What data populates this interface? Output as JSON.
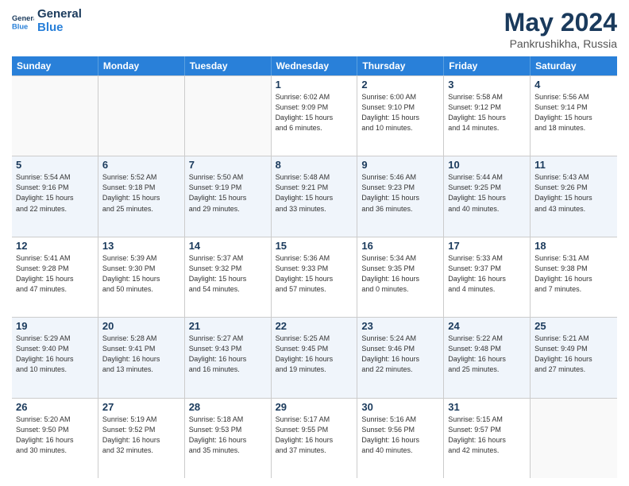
{
  "logo": {
    "line1": "General",
    "line2": "Blue"
  },
  "title": {
    "month_year": "May 2024",
    "location": "Pankrushikha, Russia"
  },
  "days_of_week": [
    "Sunday",
    "Monday",
    "Tuesday",
    "Wednesday",
    "Thursday",
    "Friday",
    "Saturday"
  ],
  "weeks": [
    [
      {
        "day": "",
        "info": ""
      },
      {
        "day": "",
        "info": ""
      },
      {
        "day": "",
        "info": ""
      },
      {
        "day": "1",
        "info": "Sunrise: 6:02 AM\nSunset: 9:09 PM\nDaylight: 15 hours\nand 6 minutes."
      },
      {
        "day": "2",
        "info": "Sunrise: 6:00 AM\nSunset: 9:10 PM\nDaylight: 15 hours\nand 10 minutes."
      },
      {
        "day": "3",
        "info": "Sunrise: 5:58 AM\nSunset: 9:12 PM\nDaylight: 15 hours\nand 14 minutes."
      },
      {
        "day": "4",
        "info": "Sunrise: 5:56 AM\nSunset: 9:14 PM\nDaylight: 15 hours\nand 18 minutes."
      }
    ],
    [
      {
        "day": "5",
        "info": "Sunrise: 5:54 AM\nSunset: 9:16 PM\nDaylight: 15 hours\nand 22 minutes."
      },
      {
        "day": "6",
        "info": "Sunrise: 5:52 AM\nSunset: 9:18 PM\nDaylight: 15 hours\nand 25 minutes."
      },
      {
        "day": "7",
        "info": "Sunrise: 5:50 AM\nSunset: 9:19 PM\nDaylight: 15 hours\nand 29 minutes."
      },
      {
        "day": "8",
        "info": "Sunrise: 5:48 AM\nSunset: 9:21 PM\nDaylight: 15 hours\nand 33 minutes."
      },
      {
        "day": "9",
        "info": "Sunrise: 5:46 AM\nSunset: 9:23 PM\nDaylight: 15 hours\nand 36 minutes."
      },
      {
        "day": "10",
        "info": "Sunrise: 5:44 AM\nSunset: 9:25 PM\nDaylight: 15 hours\nand 40 minutes."
      },
      {
        "day": "11",
        "info": "Sunrise: 5:43 AM\nSunset: 9:26 PM\nDaylight: 15 hours\nand 43 minutes."
      }
    ],
    [
      {
        "day": "12",
        "info": "Sunrise: 5:41 AM\nSunset: 9:28 PM\nDaylight: 15 hours\nand 47 minutes."
      },
      {
        "day": "13",
        "info": "Sunrise: 5:39 AM\nSunset: 9:30 PM\nDaylight: 15 hours\nand 50 minutes."
      },
      {
        "day": "14",
        "info": "Sunrise: 5:37 AM\nSunset: 9:32 PM\nDaylight: 15 hours\nand 54 minutes."
      },
      {
        "day": "15",
        "info": "Sunrise: 5:36 AM\nSunset: 9:33 PM\nDaylight: 15 hours\nand 57 minutes."
      },
      {
        "day": "16",
        "info": "Sunrise: 5:34 AM\nSunset: 9:35 PM\nDaylight: 16 hours\nand 0 minutes."
      },
      {
        "day": "17",
        "info": "Sunrise: 5:33 AM\nSunset: 9:37 PM\nDaylight: 16 hours\nand 4 minutes."
      },
      {
        "day": "18",
        "info": "Sunrise: 5:31 AM\nSunset: 9:38 PM\nDaylight: 16 hours\nand 7 minutes."
      }
    ],
    [
      {
        "day": "19",
        "info": "Sunrise: 5:29 AM\nSunset: 9:40 PM\nDaylight: 16 hours\nand 10 minutes."
      },
      {
        "day": "20",
        "info": "Sunrise: 5:28 AM\nSunset: 9:41 PM\nDaylight: 16 hours\nand 13 minutes."
      },
      {
        "day": "21",
        "info": "Sunrise: 5:27 AM\nSunset: 9:43 PM\nDaylight: 16 hours\nand 16 minutes."
      },
      {
        "day": "22",
        "info": "Sunrise: 5:25 AM\nSunset: 9:45 PM\nDaylight: 16 hours\nand 19 minutes."
      },
      {
        "day": "23",
        "info": "Sunrise: 5:24 AM\nSunset: 9:46 PM\nDaylight: 16 hours\nand 22 minutes."
      },
      {
        "day": "24",
        "info": "Sunrise: 5:22 AM\nSunset: 9:48 PM\nDaylight: 16 hours\nand 25 minutes."
      },
      {
        "day": "25",
        "info": "Sunrise: 5:21 AM\nSunset: 9:49 PM\nDaylight: 16 hours\nand 27 minutes."
      }
    ],
    [
      {
        "day": "26",
        "info": "Sunrise: 5:20 AM\nSunset: 9:50 PM\nDaylight: 16 hours\nand 30 minutes."
      },
      {
        "day": "27",
        "info": "Sunrise: 5:19 AM\nSunset: 9:52 PM\nDaylight: 16 hours\nand 32 minutes."
      },
      {
        "day": "28",
        "info": "Sunrise: 5:18 AM\nSunset: 9:53 PM\nDaylight: 16 hours\nand 35 minutes."
      },
      {
        "day": "29",
        "info": "Sunrise: 5:17 AM\nSunset: 9:55 PM\nDaylight: 16 hours\nand 37 minutes."
      },
      {
        "day": "30",
        "info": "Sunrise: 5:16 AM\nSunset: 9:56 PM\nDaylight: 16 hours\nand 40 minutes."
      },
      {
        "day": "31",
        "info": "Sunrise: 5:15 AM\nSunset: 9:57 PM\nDaylight: 16 hours\nand 42 minutes."
      },
      {
        "day": "",
        "info": ""
      }
    ]
  ]
}
